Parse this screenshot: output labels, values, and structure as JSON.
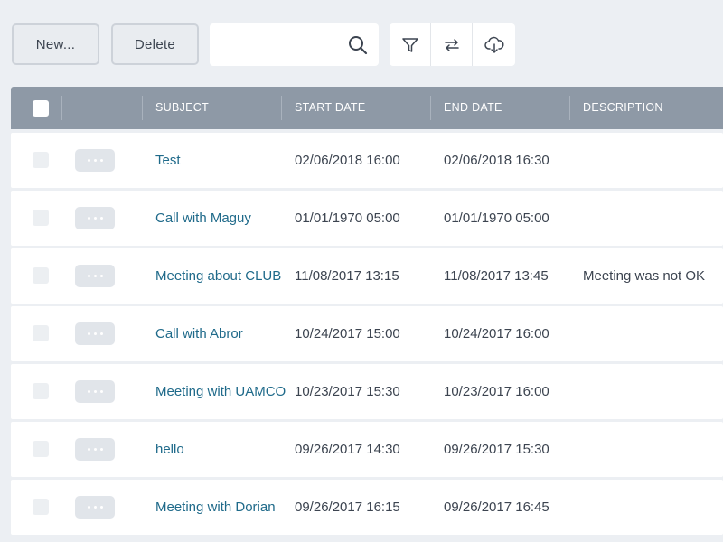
{
  "toolbar": {
    "new_label": "New...",
    "delete_label": "Delete",
    "search_value": "",
    "icons": [
      "filter-icon",
      "refresh-icon",
      "cloud-download-icon"
    ]
  },
  "grid": {
    "columns": [
      "",
      "",
      "SUBJECT",
      "START DATE",
      "END DATE",
      "DESCRIPTION"
    ],
    "rows": [
      {
        "subject": "Test",
        "start": "02/06/2018 16:00",
        "end": "02/06/2018 16:30",
        "description": ""
      },
      {
        "subject": "Call with Maguy",
        "start": "01/01/1970 05:00",
        "end": "01/01/1970 05:00",
        "description": ""
      },
      {
        "subject": "Meeting about CLUB",
        "start": "11/08/2017 13:15",
        "end": "11/08/2017 13:45",
        "description": "Meeting was not OK"
      },
      {
        "subject": "Call with Abror",
        "start": "10/24/2017 15:00",
        "end": "10/24/2017 16:00",
        "description": ""
      },
      {
        "subject": "Meeting with UAMCO",
        "start": "10/23/2017 15:30",
        "end": "10/23/2017 16:00",
        "description": ""
      },
      {
        "subject": "hello",
        "start": "09/26/2017 14:30",
        "end": "09/26/2017 15:30",
        "description": ""
      },
      {
        "subject": "Meeting with Dorian",
        "start": "09/26/2017 16:15",
        "end": "09/26/2017 16:45",
        "description": ""
      }
    ]
  },
  "colors": {
    "background": "#eceff3",
    "header": "#8e99a6",
    "link": "#1f6a8a",
    "text": "#3c4450"
  }
}
